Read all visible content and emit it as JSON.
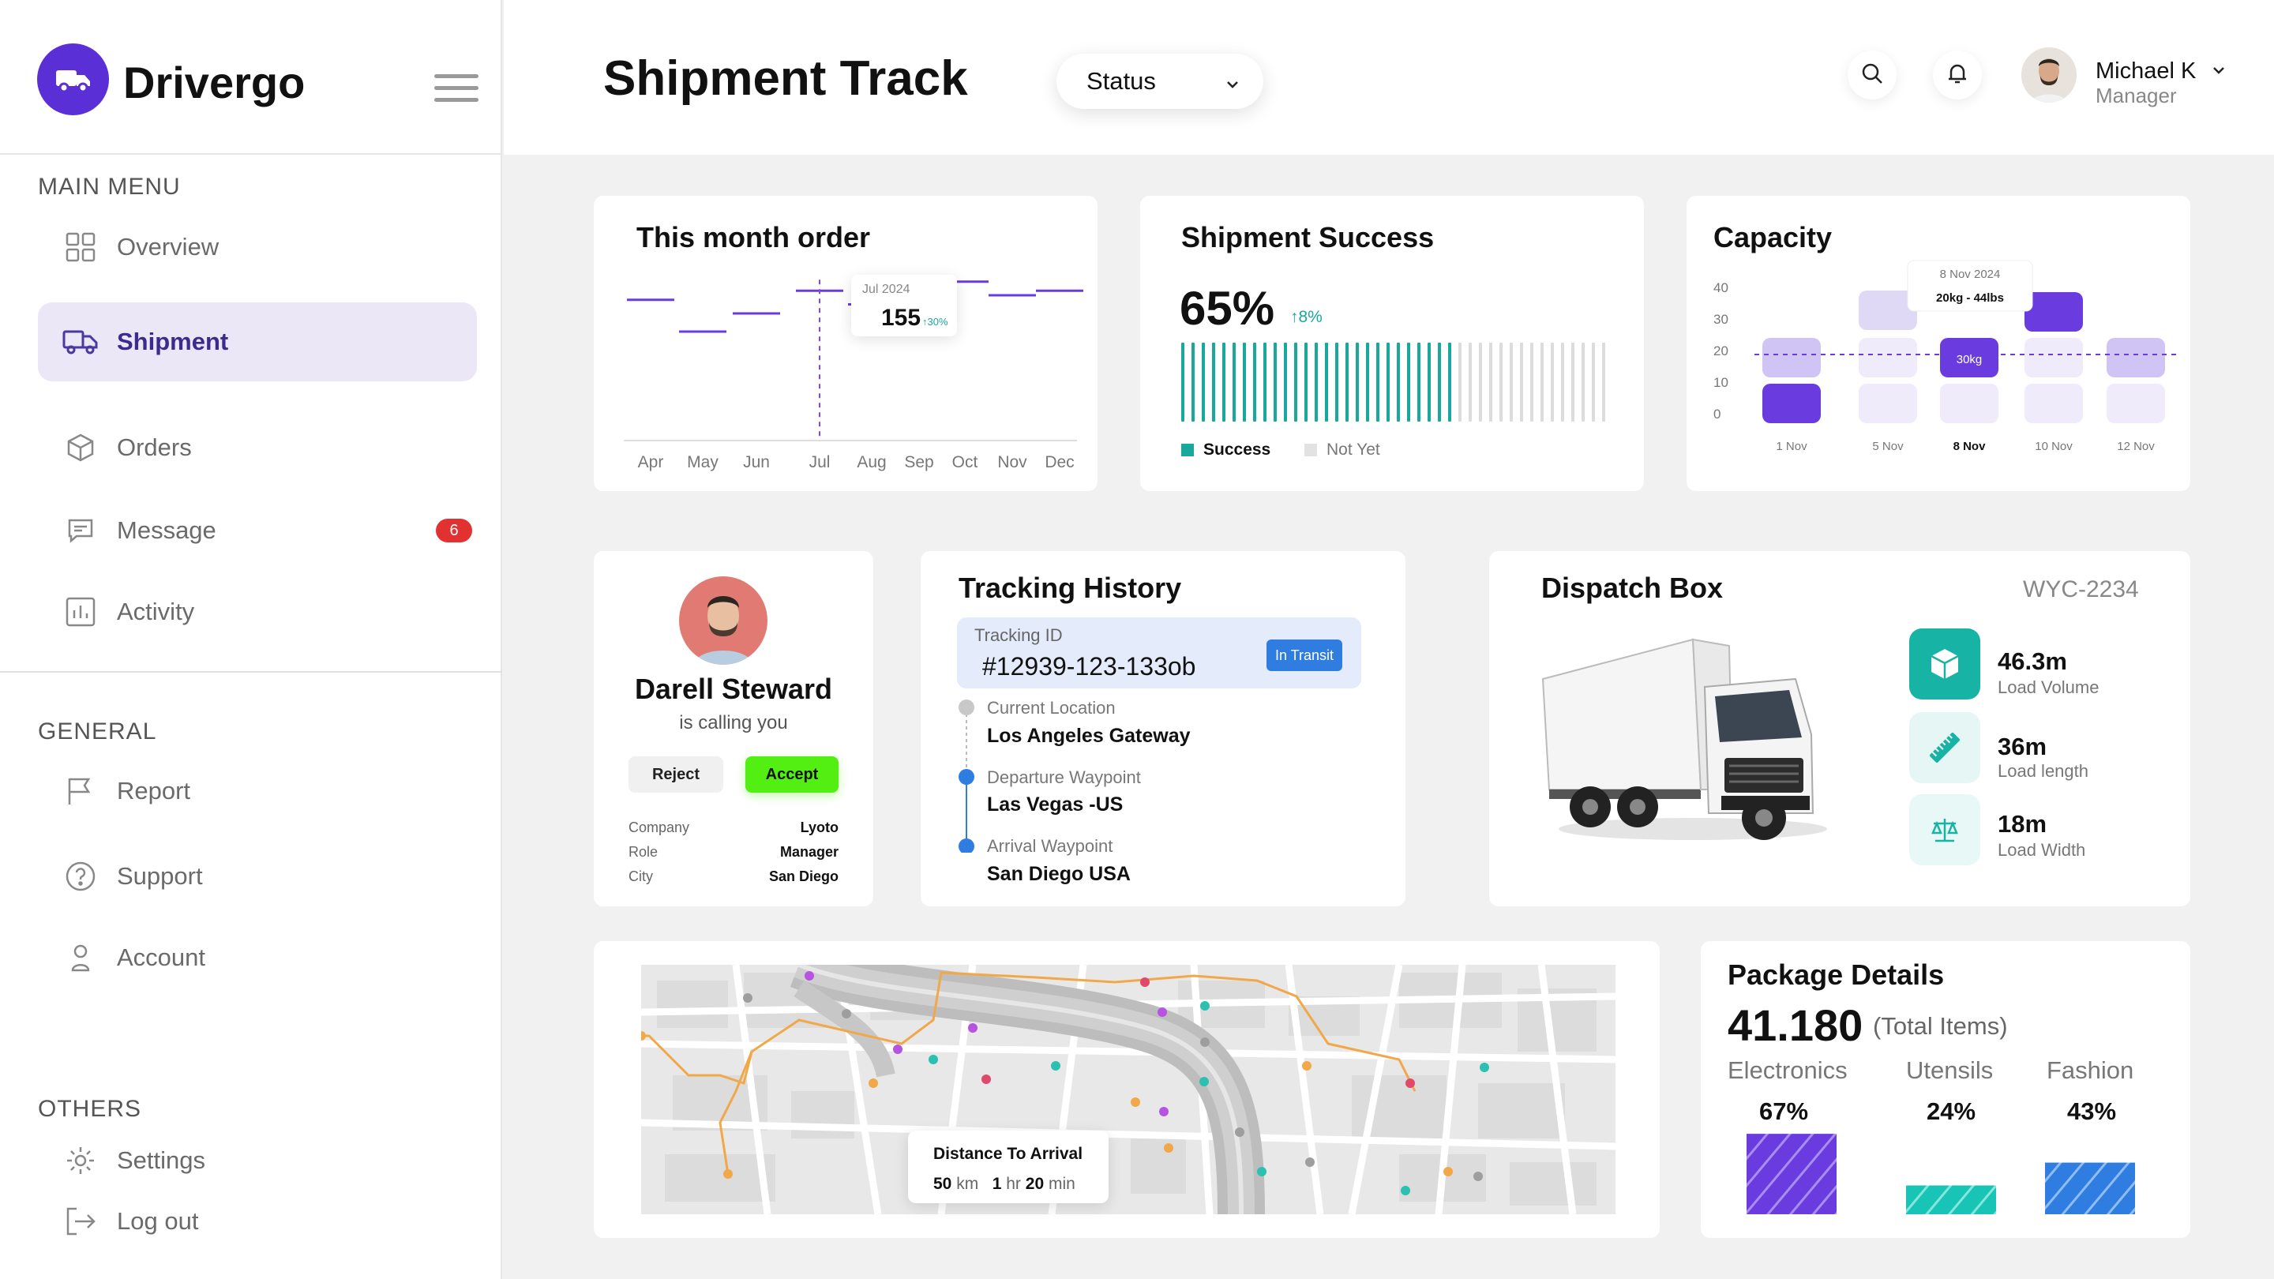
{
  "app": {
    "name": "Drivergo"
  },
  "sidebar": {
    "main_menu_title": "MAIN MENU",
    "items": [
      {
        "label": "Overview"
      },
      {
        "label": "Shipment"
      },
      {
        "label": "Orders"
      },
      {
        "label": "Message",
        "badge": "6"
      },
      {
        "label": "Activity"
      }
    ],
    "general_title": "GENERAL",
    "general_items": [
      {
        "label": "Report"
      },
      {
        "label": "Support"
      },
      {
        "label": "Account"
      }
    ],
    "others_title": "OTHERS",
    "others_items": [
      {
        "label": "Settings"
      },
      {
        "label": "Log out"
      }
    ]
  },
  "header": {
    "title": "Shipment Track",
    "status_dropdown": "Status",
    "user": {
      "name": "Michael K",
      "role": "Manager"
    }
  },
  "month_order": {
    "title": "This month order",
    "tooltip": {
      "date": "Jul 2024",
      "value": "155",
      "change": "↑30%"
    },
    "chart_data": {
      "type": "line",
      "categories": [
        "Apr",
        "May",
        "Jun",
        "Jul",
        "Aug",
        "Sep",
        "Oct",
        "Nov",
        "Dec"
      ],
      "values": [
        155,
        120,
        140,
        165,
        150,
        165,
        175,
        160,
        165
      ],
      "highlight": "Jul"
    }
  },
  "shipment_success": {
    "title": "Shipment Success",
    "value": "65%",
    "change": "↑8%",
    "legend": [
      "Success",
      "Not Yet"
    ],
    "chart_data": {
      "type": "bar",
      "success_fraction": 0.65,
      "bars_total": 42
    },
    "colors": {
      "success": "#1aa89c",
      "not_yet": "#dcdcdc"
    }
  },
  "capacity": {
    "title": "Capacity",
    "tooltip": {
      "date": "8 Nov 2024",
      "value": "20kg - 44lbs"
    },
    "selected_label": "30kg",
    "chart_data": {
      "type": "bar",
      "yticks": [
        "40",
        "30",
        "20",
        "10",
        "0"
      ],
      "categories": [
        "1 Nov",
        "5 Nov",
        "8 Nov",
        "10 Nov",
        "12 Nov"
      ],
      "reference_line": 20
    }
  },
  "caller": {
    "name": "Darell Steward",
    "subtitle": "is calling you",
    "reject": "Reject",
    "accept": "Accept",
    "details": [
      {
        "key": "Company",
        "value": "Lyoto"
      },
      {
        "key": "Role",
        "value": "Manager"
      },
      {
        "key": "City",
        "value": "San Diego"
      }
    ]
  },
  "tracking": {
    "title": "Tracking History",
    "id_label": "Tracking ID",
    "id": "#12939-123-133ob",
    "badge": "In Transit",
    "steps": [
      {
        "label": "Current Location",
        "value": "Los Angeles Gateway"
      },
      {
        "label": "Departure Waypoint",
        "value": "Las Vegas -US"
      },
      {
        "label": "Arrival Waypoint",
        "value": "San Diego USA"
      }
    ]
  },
  "dispatch": {
    "title": "Dispatch Box",
    "code": "WYC-2234",
    "dims": [
      {
        "value": "46.3m",
        "label": "Load Volume"
      },
      {
        "value": "36m",
        "label": "Load length"
      },
      {
        "value": "18m",
        "label": "Load Width"
      }
    ]
  },
  "map": {
    "distance_label": "Distance To Arrival",
    "distance": {
      "km_num": "50",
      "km_unit": "km",
      "hr_num": "1",
      "hr_unit": "hr",
      "min_num": "20",
      "min_unit": "min"
    }
  },
  "package": {
    "title": "Package Details",
    "total": "41.180",
    "total_label": "(Total Items)",
    "categories": [
      {
        "name": "Electronics",
        "pct": "67%"
      },
      {
        "name": "Utensils",
        "pct": "24%"
      },
      {
        "name": "Fashion",
        "pct": "43%"
      }
    ],
    "chart_data": {
      "type": "bar",
      "categories": [
        "Electronics",
        "Utensils",
        "Fashion"
      ],
      "values": [
        67,
        24,
        43
      ]
    }
  }
}
